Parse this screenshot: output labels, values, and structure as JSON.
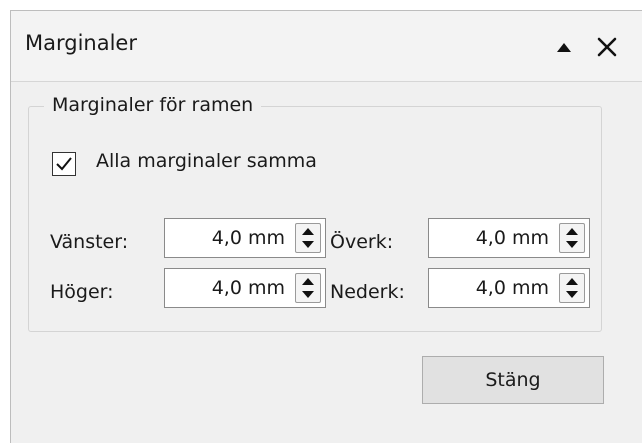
{
  "window": {
    "title": "Marginaler",
    "collapse_icon": "triangle-up-icon",
    "close_icon": "close-icon"
  },
  "group": {
    "legend": "Marginaler för ramen",
    "all_same": {
      "label": "Alla marginaler samma",
      "checked": true
    },
    "fields": {
      "left": {
        "label": "Vänster:",
        "value": "4,0 mm"
      },
      "top": {
        "label": "Överk:",
        "value": "4,0 mm"
      },
      "right": {
        "label": "Höger:",
        "value": "4,0 mm"
      },
      "bottom": {
        "label": "Nederk:",
        "value": "4,0 mm"
      }
    }
  },
  "footer": {
    "close_label": "Stäng"
  }
}
